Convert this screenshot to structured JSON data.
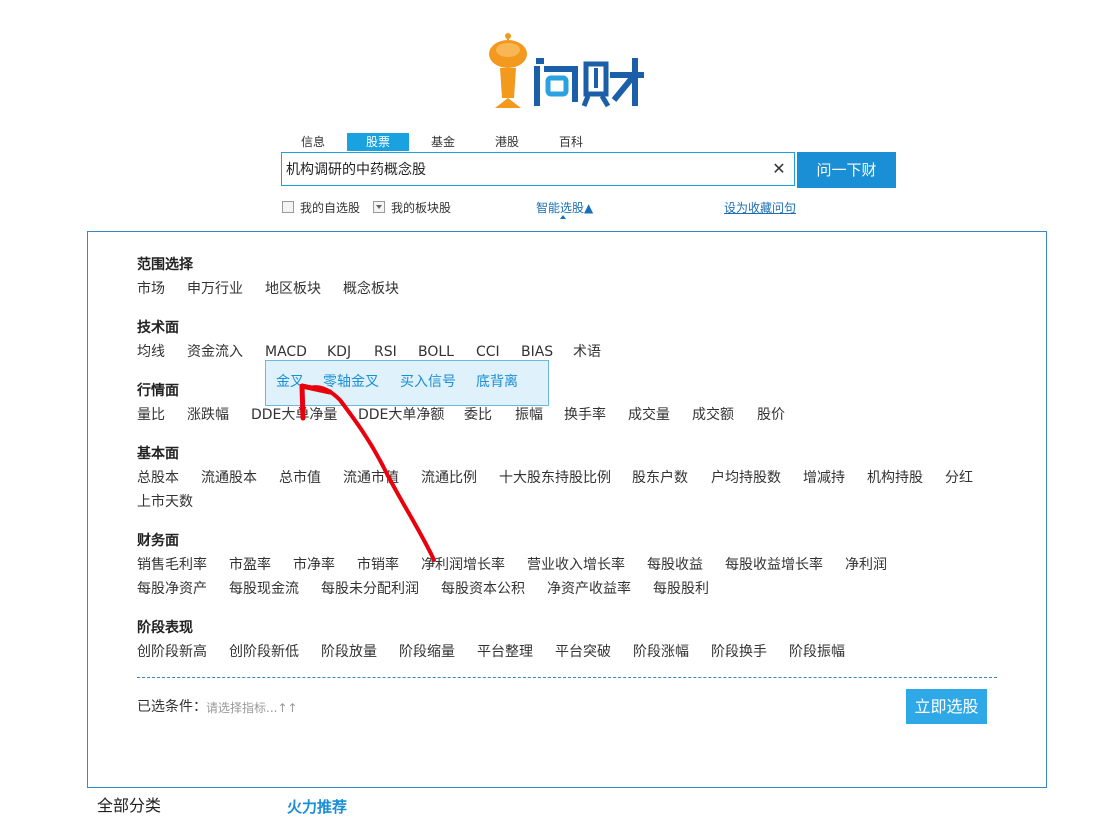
{
  "logo": {
    "text": "问财"
  },
  "tabs": [
    "信息",
    "股票",
    "基金",
    "港股",
    "百科"
  ],
  "active_tab": "股票",
  "search": {
    "value": "机构调研的中药概念股",
    "clear_icon": "close-icon",
    "button": "问一下财"
  },
  "options": {
    "my_stocks": "我的自选股",
    "my_sectors": "我的板块股",
    "smart_pick": "智能选股▲",
    "save_fav": "设为收藏问句"
  },
  "sections": [
    {
      "title": "范围选择",
      "rows": [
        [
          "市场",
          "申万行业",
          "地区板块",
          "概念板块"
        ]
      ]
    },
    {
      "title": "技术面",
      "rows": [
        [
          "均线",
          "资金流入",
          "MACD",
          "KDJ",
          "RSI",
          "BOLL",
          "CCI",
          "BIAS",
          "术语"
        ]
      ]
    },
    {
      "title": "行情面",
      "rows": [
        [
          "量比",
          "涨跌幅",
          "DDE大单净量",
          "DDE大单净额",
          "委比",
          "振幅",
          "换手率",
          "成交量",
          "成交额",
          "股价"
        ]
      ]
    },
    {
      "title": "基本面",
      "rows": [
        [
          "总股本",
          "流通股本",
          "总市值",
          "流通市值",
          "流通比例",
          "十大股东持股比例",
          "股东户数",
          "户均持股数",
          "增减持",
          "机构持股",
          "分红"
        ],
        [
          "上市天数"
        ]
      ]
    },
    {
      "title": "财务面",
      "rows": [
        [
          "销售毛利率",
          "市盈率",
          "市净率",
          "市销率",
          "净利润增长率",
          "营业收入增长率",
          "每股收益",
          "每股收益增长率",
          "净利润"
        ],
        [
          "每股净资产",
          "每股现金流",
          "每股未分配利润",
          "每股资本公积",
          "净资产收益率",
          "每股股利"
        ]
      ]
    },
    {
      "title": "阶段表现",
      "rows": [
        [
          "创阶段新高",
          "创阶段新低",
          "阶段放量",
          "阶段缩量",
          "平台整理",
          "平台突破",
          "阶段涨幅",
          "阶段换手",
          "阶段振幅"
        ]
      ]
    }
  ],
  "macd_submenu": [
    "金叉",
    "零轴金叉",
    "买入信号",
    "底背离"
  ],
  "selected": {
    "label": "已选条件：",
    "hint": "请选择指标...↑↑"
  },
  "pick_button": "立即选股",
  "bottom": {
    "all_categories": "全部分类",
    "hot": "火力推荐"
  },
  "annotation": {
    "type": "red-hand-drawn-arrow",
    "color": "#e8000c"
  }
}
